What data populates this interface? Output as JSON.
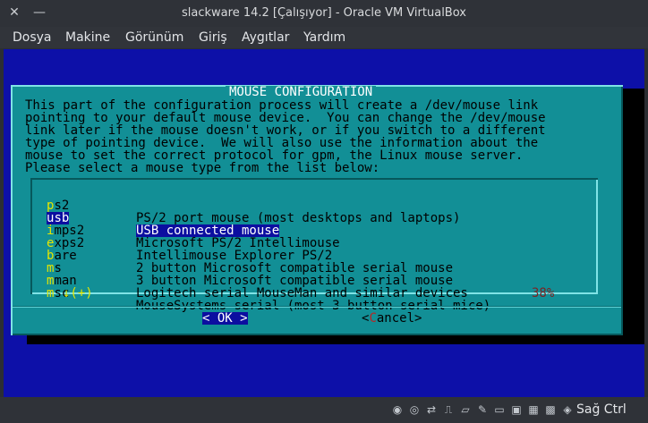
{
  "window": {
    "title": "slackware 14.2 [Çalışıyor] - Oracle VM VirtualBox",
    "close_glyph": "✕",
    "minimize_glyph": "—"
  },
  "menubar": {
    "items": [
      "Dosya",
      "Makine",
      "Görünüm",
      "Giriş",
      "Aygıtlar",
      "Yardım"
    ]
  },
  "dialog": {
    "title": "MOUSE CONFIGURATION",
    "body": [
      "This part of the configuration process will create a /dev/mouse link",
      "pointing to your default mouse device.  You can change the /dev/mouse",
      "link later if the mouse doesn't work, or if you switch to a different",
      "type of pointing device.  We will also use the information about the",
      "mouse to set the correct protocol for gpm, the Linux mouse server.",
      "Please select a mouse type from the list below:"
    ],
    "list": [
      {
        "hot": "p",
        "rest": "s2",
        "desc": "PS/2 port mouse (most desktops and laptops)",
        "selected": false
      },
      {
        "hot": "u",
        "rest": "sb",
        "desc": "USB connected mouse",
        "selected": true
      },
      {
        "hot": "i",
        "rest": "mps2",
        "desc": "Microsoft PS/2 Intellimouse",
        "selected": false
      },
      {
        "hot": "e",
        "rest": "xps2",
        "desc": "Intellimouse Explorer PS/2",
        "selected": false
      },
      {
        "hot": "b",
        "rest": "are",
        "desc": "2 button Microsoft compatible serial mouse",
        "selected": false
      },
      {
        "hot": "m",
        "rest": "s",
        "desc": "3 button Microsoft compatible serial mouse",
        "selected": false
      },
      {
        "hot": "m",
        "rest": "man",
        "desc": "Logitech serial MouseMan and similar devices",
        "selected": false
      },
      {
        "hot": "m",
        "rest": "sc",
        "desc": "MouseSystems serial (most 3 button serial mice)",
        "selected": false
      }
    ],
    "scroll_indicator": "↓(+)",
    "scroll_percent": "38%",
    "ok_button": {
      "left": "<",
      "label": " OK ",
      "right": ">"
    },
    "cancel_button": {
      "left": "<",
      "hot": "C",
      "rest": "ancel",
      "right": ">"
    }
  },
  "statusbar": {
    "icons": [
      {
        "name": "optical-drive-icon",
        "glyph": "◉"
      },
      {
        "name": "audio-icon",
        "glyph": "◎"
      },
      {
        "name": "network-icon",
        "glyph": "⇄"
      },
      {
        "name": "usb-icon",
        "glyph": "⎍"
      },
      {
        "name": "shared-folders-icon",
        "glyph": "▱"
      },
      {
        "name": "pencil-icon",
        "glyph": "✎"
      },
      {
        "name": "display-icon",
        "glyph": "▭"
      },
      {
        "name": "video-capture-icon",
        "glyph": "▣"
      },
      {
        "name": "recording-icon",
        "glyph": "▦"
      },
      {
        "name": "processor-icon",
        "glyph": "▩"
      },
      {
        "name": "cpu-load-icon",
        "glyph": "◈"
      },
      {
        "name": "mouse-integration-icon",
        "glyph": "⬉"
      },
      {
        "name": "keyboard-icon",
        "glyph": "⌨"
      }
    ],
    "host_key": "Sağ Ctrl"
  },
  "colors": {
    "vm_background": "#0d10a8",
    "dialog_background": "#128f96",
    "highlight": "#0c0ea0",
    "hotkey_yellow": "#e6e600",
    "hotkey_red": "#b82626"
  }
}
